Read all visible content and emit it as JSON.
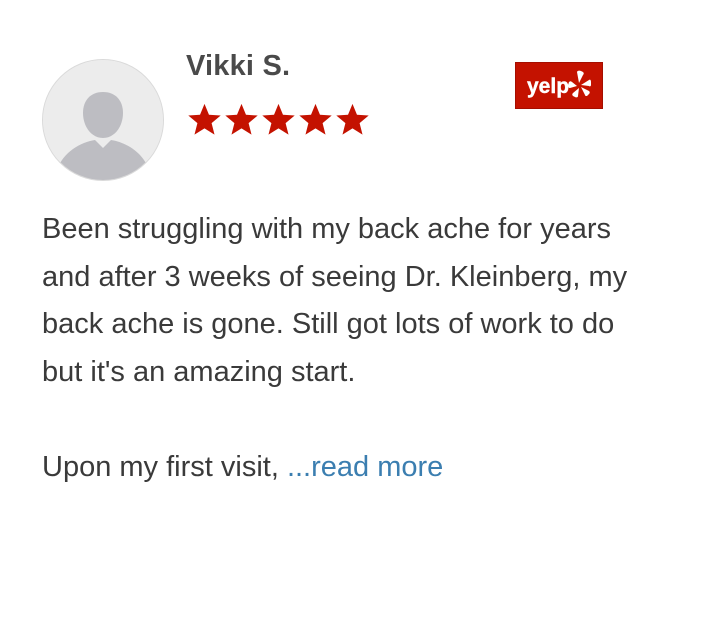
{
  "review": {
    "reviewer_name": "Vikki S.",
    "rating": 5,
    "rating_max": 5,
    "source_logo_text": "yelp",
    "paragraph_1": "Been struggling with my back ache for years and after 3 weeks of seeing Dr. Kleinberg, my back ache is gone. Still got lots of work to do but it's an amazing start.",
    "paragraph_2_prefix": "Upon my first visit, ",
    "read_more_label": "...read more"
  },
  "colors": {
    "star": "#c41200",
    "yelp_brand": "#c41200",
    "link": "#3b7eb0",
    "text": "#3a3a3a"
  },
  "icons": {
    "avatar": "user-silhouette-icon",
    "star": "star-icon",
    "source": "yelp-logo-icon"
  }
}
